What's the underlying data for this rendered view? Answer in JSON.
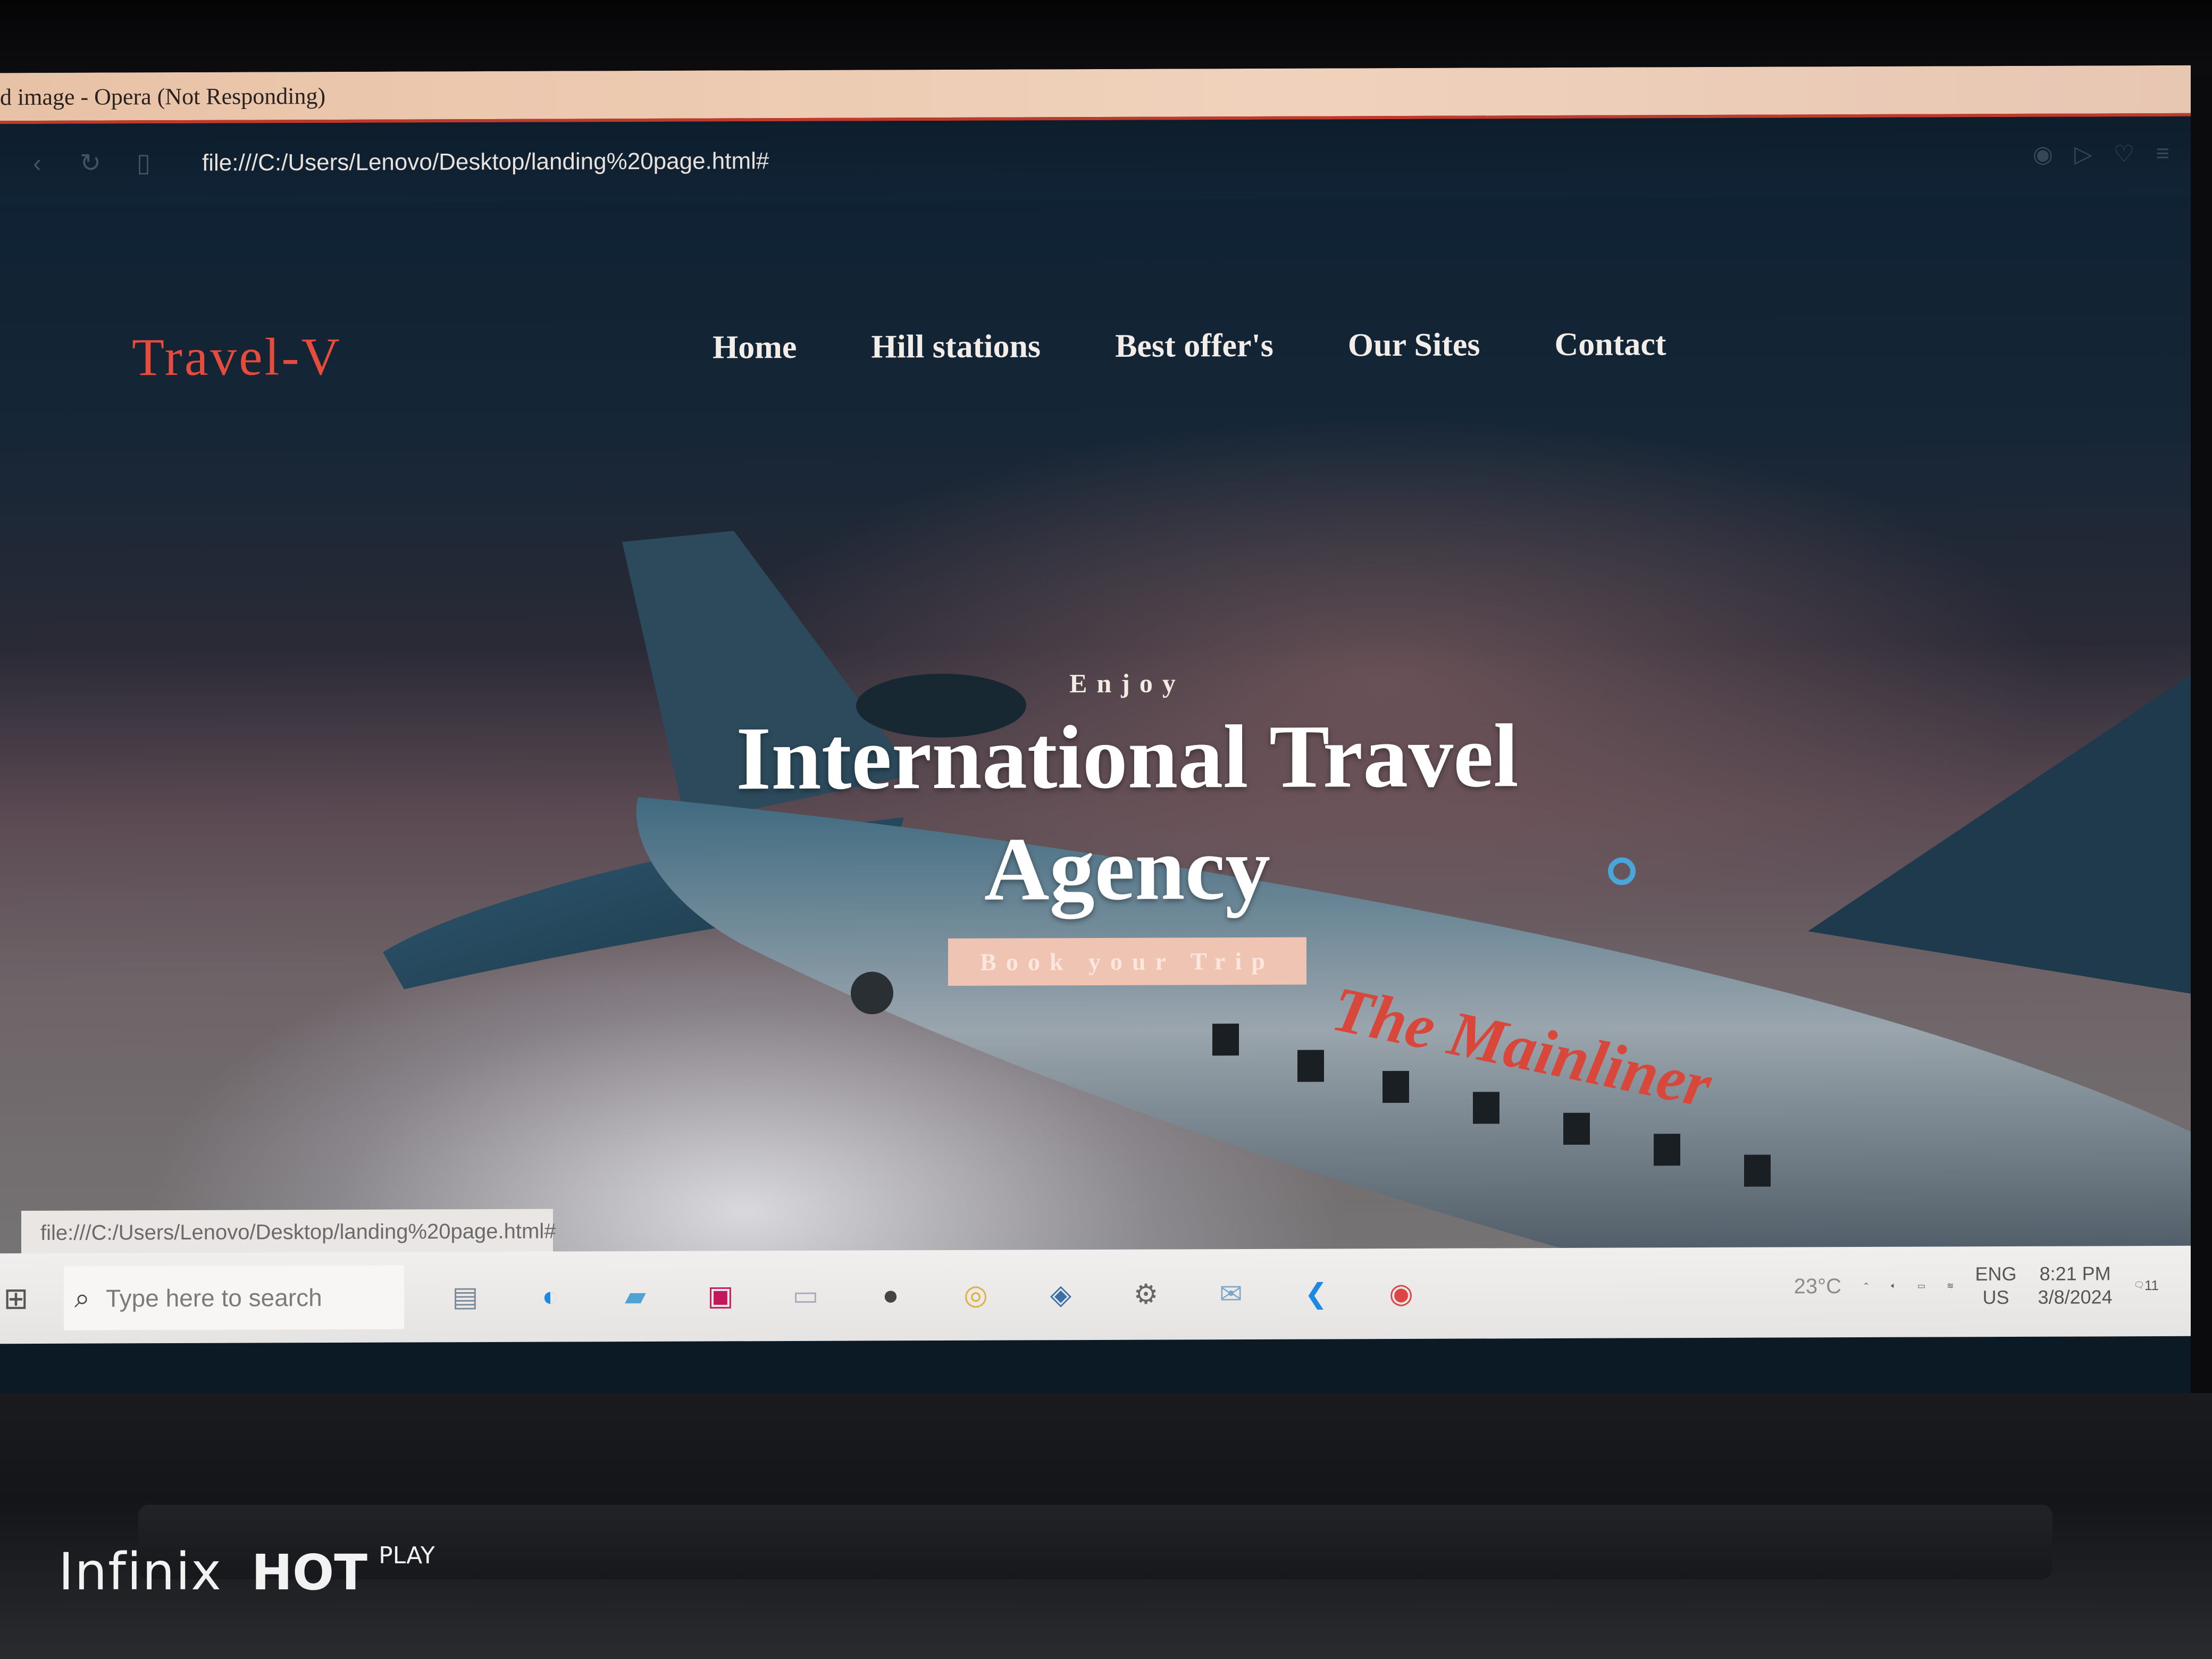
{
  "window": {
    "title": "d image - Opera (Not Responding)"
  },
  "browser": {
    "url": "file:///C:/Users/Lenovo/Desktop/landing%20page.html#"
  },
  "site": {
    "logo": "Travel-V",
    "nav": [
      "Home",
      "Hill stations",
      "Best offer's",
      "Our Sites",
      "Contact"
    ],
    "hero": {
      "kicker": "Enjoy",
      "title_line1": "International Travel",
      "title_line2": "Agency",
      "cta": "Book your Trip"
    },
    "plane_livery": "The Mainliner"
  },
  "status_bar": {
    "url": "file:///C:/Users/Lenovo/Desktop/landing%20page.html#"
  },
  "taskbar": {
    "search_placeholder": "Type here to search",
    "weather": "23°C",
    "language": "ENG",
    "region": "US",
    "time": "8:21 PM",
    "date": "3/8/2024",
    "notification_count": "11",
    "icons": [
      "task-view-icon",
      "edge-icon",
      "file-explorer-icon",
      "media-app-icon",
      "store-icon",
      "app-icon",
      "chrome-icon",
      "vpn-icon",
      "settings-icon",
      "mail-icon",
      "vscode-icon",
      "chrome-icon"
    ]
  },
  "photo": {
    "watermark_brand": "Infinix",
    "watermark_model": "HOT",
    "watermark_sub": "PLAY"
  },
  "colors": {
    "accent": "#e64b3c",
    "cta_bg": "#efc4b2",
    "titlebar": "#f0d2bc"
  }
}
